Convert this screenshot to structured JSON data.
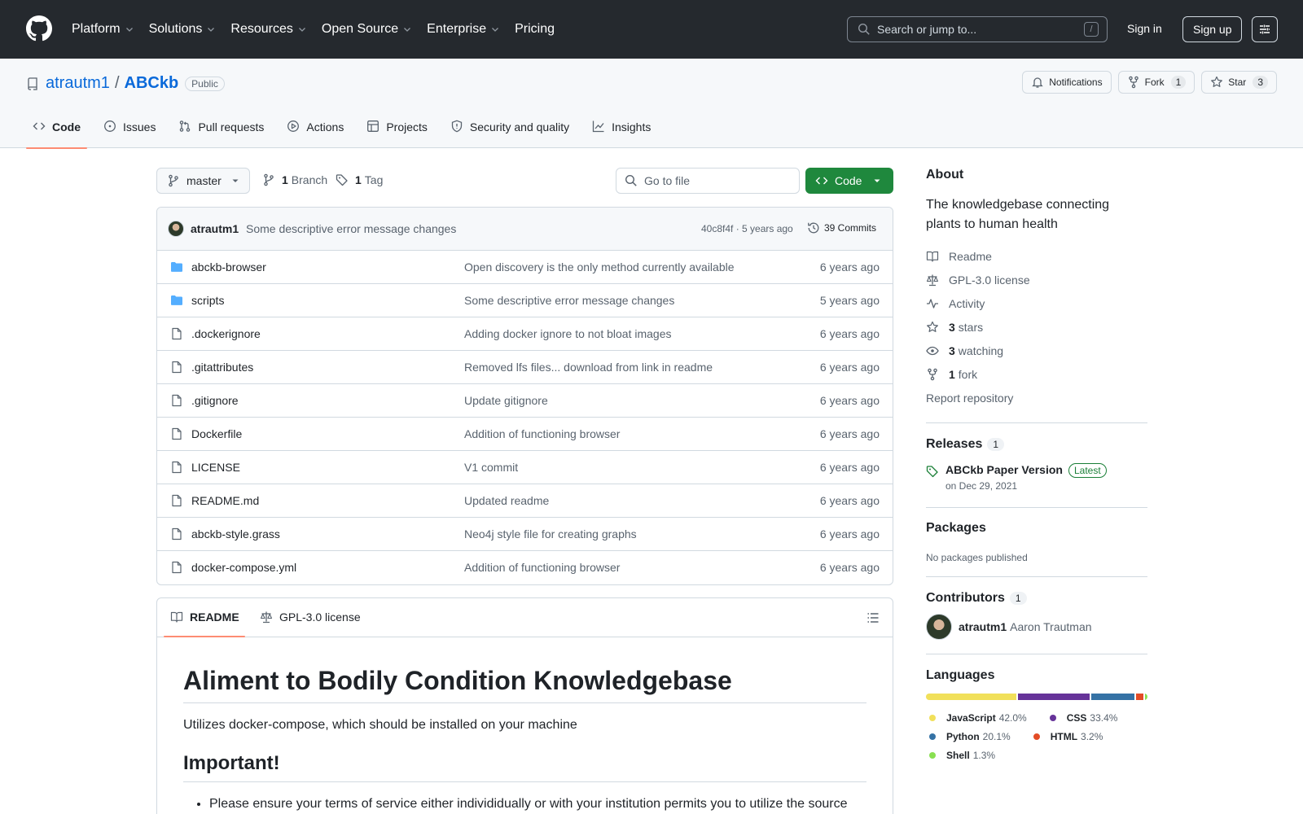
{
  "header": {
    "nav": [
      {
        "label": "Platform",
        "dropdown": true
      },
      {
        "label": "Solutions",
        "dropdown": true
      },
      {
        "label": "Resources",
        "dropdown": true
      },
      {
        "label": "Open Source",
        "dropdown": true
      },
      {
        "label": "Enterprise",
        "dropdown": true
      },
      {
        "label": "Pricing",
        "dropdown": false
      }
    ],
    "search_placeholder": "Search or jump to...",
    "search_key": "/",
    "sign_in": "Sign in",
    "sign_up": "Sign up"
  },
  "repo": {
    "owner": "atrautm1",
    "separator": "/",
    "name": "ABCkb",
    "visibility": "Public",
    "notifications_label": "Notifications",
    "fork_label": "Fork",
    "fork_count": "1",
    "star_label": "Star",
    "star_count": "3"
  },
  "tabs": [
    {
      "label": "Code",
      "icon": "code-icon",
      "active": true
    },
    {
      "label": "Issues",
      "icon": "issue-icon",
      "active": false
    },
    {
      "label": "Pull requests",
      "icon": "pull-request-icon",
      "active": false
    },
    {
      "label": "Actions",
      "icon": "play-icon",
      "active": false
    },
    {
      "label": "Projects",
      "icon": "table-icon",
      "active": false
    },
    {
      "label": "Security and quality",
      "icon": "shield-icon",
      "active": false
    },
    {
      "label": "Insights",
      "icon": "graph-icon",
      "active": false
    }
  ],
  "branchbar": {
    "branch": "master",
    "branch_count": "1",
    "branch_label": "Branch",
    "tag_count": "1",
    "tag_label": "Tag",
    "go_to_file": "Go to file",
    "code_label": "Code"
  },
  "latest_commit": {
    "author": "atrautm1",
    "message": "Some descriptive error message changes",
    "meta": "40c8f4f · 5 years ago",
    "commits_label": "39 Commits"
  },
  "files": [
    {
      "type": "dir",
      "name": "abckb-browser",
      "message": "Open discovery is the only method currently available",
      "age": "6 years ago"
    },
    {
      "type": "dir",
      "name": "scripts",
      "message": "Some descriptive error message changes",
      "age": "5 years ago"
    },
    {
      "type": "file",
      "name": ".dockerignore",
      "message": "Adding docker ignore to not bloat images",
      "age": "6 years ago"
    },
    {
      "type": "file",
      "name": ".gitattributes",
      "message": "Removed lfs files... download from link in readme",
      "age": "6 years ago"
    },
    {
      "type": "file",
      "name": ".gitignore",
      "message": "Update gitignore",
      "age": "6 years ago"
    },
    {
      "type": "file",
      "name": "Dockerfile",
      "message": "Addition of functioning browser",
      "age": "6 years ago"
    },
    {
      "type": "file",
      "name": "LICENSE",
      "message": "V1 commit",
      "age": "6 years ago"
    },
    {
      "type": "file",
      "name": "README.md",
      "message": "Updated readme",
      "age": "6 years ago"
    },
    {
      "type": "file",
      "name": "abckb-style.grass",
      "message": "Neo4j style file for creating graphs",
      "age": "6 years ago"
    },
    {
      "type": "file",
      "name": "docker-compose.yml",
      "message": "Addition of functioning browser",
      "age": "6 years ago"
    }
  ],
  "readme": {
    "tab_readme": "README",
    "tab_license": "GPL-3.0 license",
    "h1": "Aliment to Bodily Condition Knowledgebase",
    "p1": "Utilizes docker-compose, which should be installed on your machine",
    "h2": "Important!",
    "li1": "Please ensure your terms of service either individidually or with your institution permits you to utilize the source"
  },
  "about": {
    "title": "About",
    "description": "The knowledgebase connecting plants to human health",
    "readme": "Readme",
    "license": "GPL-3.0 license",
    "activity": "Activity",
    "stars_count": "3",
    "stars_label": "stars",
    "watching_count": "3",
    "watching_label": "watching",
    "fork_count": "1",
    "fork_label": "fork",
    "report": "Report repository"
  },
  "releases": {
    "title": "Releases",
    "count": "1",
    "name": "ABCkb Paper Version",
    "badge": "Latest",
    "date": "on Dec 29, 2021"
  },
  "packages": {
    "title": "Packages",
    "empty": "No packages published"
  },
  "contributors": {
    "title": "Contributors",
    "count": "1",
    "login": "atrautm1",
    "full_name": "Aaron Trautman"
  },
  "languages": {
    "title": "Languages",
    "items": [
      {
        "name": "JavaScript",
        "percent": 42.0,
        "label": "42.0%",
        "color": "#f1e05a"
      },
      {
        "name": "CSS",
        "percent": 33.4,
        "label": "33.4%",
        "color": "#663399"
      },
      {
        "name": "Python",
        "percent": 20.1,
        "label": "20.1%",
        "color": "#3572A5"
      },
      {
        "name": "HTML",
        "percent": 3.2,
        "label": "3.2%",
        "color": "#e34c26"
      },
      {
        "name": "Shell",
        "percent": 1.3,
        "label": "1.3%",
        "color": "#89e051"
      }
    ]
  }
}
